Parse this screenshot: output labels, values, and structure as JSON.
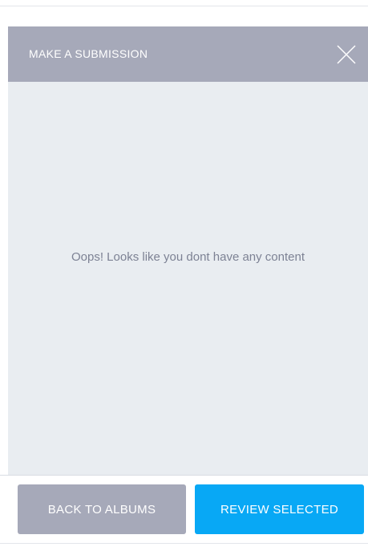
{
  "header": {
    "title": "MAKE A SUBMISSION",
    "close_icon": "close-icon"
  },
  "content": {
    "empty_message": "Oops! Looks like you dont have any content"
  },
  "footer": {
    "back_label": "BACK TO ALBUMS",
    "review_label": "REVIEW SELECTED"
  },
  "colors": {
    "header_bg": "#a6a9b9",
    "content_bg": "#e9edf1",
    "secondary_button": "#a6a9b9",
    "primary_button": "#08a8f5",
    "message_text": "#7d8294"
  }
}
